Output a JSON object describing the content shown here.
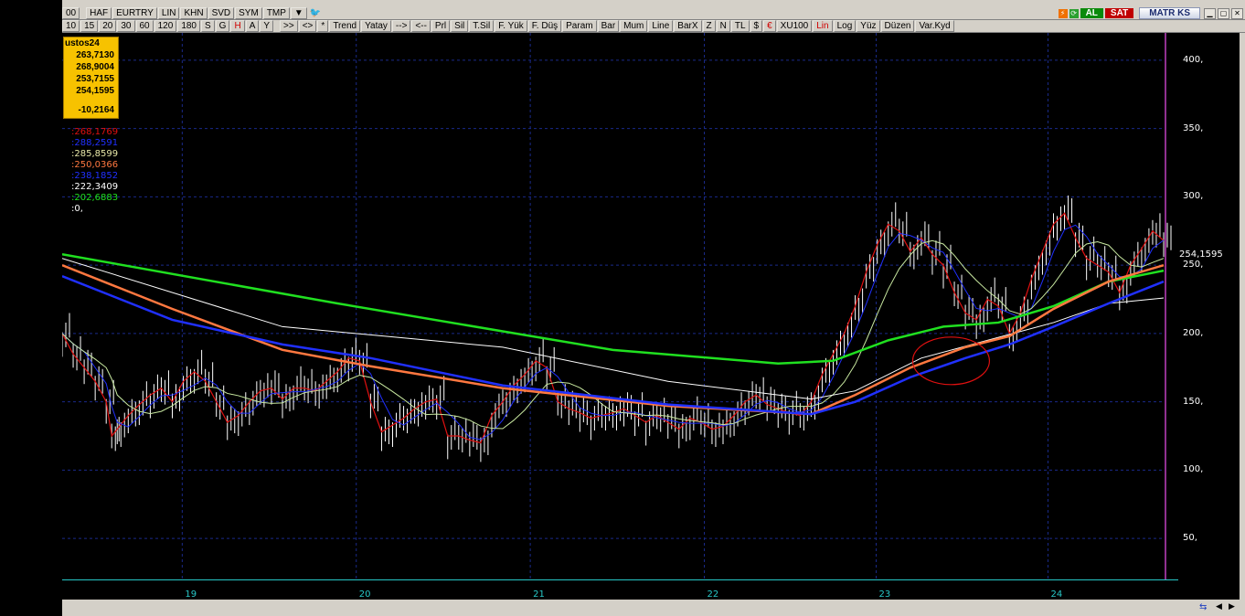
{
  "toolbar": {
    "row1": [
      "00",
      "HAF",
      "EURTRY",
      "LIN",
      "KHN",
      "SVD",
      "SYM",
      "TMP"
    ],
    "row2_periods": [
      "10",
      "15",
      "20",
      "30",
      "60",
      "120",
      "180",
      "S",
      "G",
      "H",
      "A",
      "Y"
    ],
    "row2_tools": [
      ">>",
      "<>",
      "*",
      "Trend",
      "Yatay",
      "-->",
      "<--",
      "Prl",
      "Sil",
      "T.Sil",
      "F. Yük",
      "F. Düş",
      "Param",
      "Bar",
      "Mum",
      "Line",
      "BarX",
      "Z",
      "N",
      "TL",
      "$",
      "€",
      "XU100",
      "Lin",
      "Log",
      "Yüz",
      "Düzen",
      "Var.Kyd"
    ],
    "al": "AL",
    "sat": "SAT",
    "brand": "MATR KS"
  },
  "infobox": {
    "title": "ustos24",
    "values": [
      "263,7130",
      "268,9004",
      "253,7155",
      "254,1595",
      "-10,2164"
    ]
  },
  "indicators": [
    {
      "value": ":268,1769",
      "color": "#e01010"
    },
    {
      "value": ":288,2591",
      "color": "#2030ff"
    },
    {
      "value": ":285,8599",
      "color": "#e8e8a8"
    },
    {
      "value": ":250,0366",
      "color": "#ff7840"
    },
    {
      "value": ":238,1852",
      "color": "#2030ff"
    },
    {
      "value": ":222,3409",
      "color": "#ffffff"
    },
    {
      "value": ":202,6883",
      "color": "#20e020"
    },
    {
      "value": ":0,",
      "color": "#ffffff"
    }
  ],
  "last_price": "254,1595",
  "chart_data": {
    "type": "line",
    "y_ticks": [
      "400,",
      "350,",
      "300,",
      "250,",
      "200,",
      "150,",
      "100,",
      "50,"
    ],
    "y_tick_values": [
      400,
      350,
      300,
      250,
      200,
      150,
      100,
      50
    ],
    "ylim": [
      20,
      420
    ],
    "x_ticks": [
      "19",
      "20",
      "21",
      "22",
      "23",
      "24"
    ],
    "x_tick_pos": [
      0.109,
      0.267,
      0.425,
      0.583,
      0.739,
      0.895
    ],
    "price": [
      [
        0,
        200
      ],
      [
        0.01,
        185
      ],
      [
        0.02,
        175
      ],
      [
        0.03,
        165
      ],
      [
        0.04,
        150
      ],
      [
        0.045,
        125
      ],
      [
        0.05,
        130
      ],
      [
        0.06,
        140
      ],
      [
        0.07,
        148
      ],
      [
        0.08,
        155
      ],
      [
        0.09,
        160
      ],
      [
        0.1,
        150
      ],
      [
        0.11,
        165
      ],
      [
        0.12,
        172
      ],
      [
        0.13,
        165
      ],
      [
        0.14,
        150
      ],
      [
        0.15,
        135
      ],
      [
        0.16,
        140
      ],
      [
        0.17,
        150
      ],
      [
        0.18,
        158
      ],
      [
        0.19,
        160
      ],
      [
        0.2,
        152
      ],
      [
        0.21,
        160
      ],
      [
        0.22,
        160
      ],
      [
        0.23,
        158
      ],
      [
        0.24,
        165
      ],
      [
        0.25,
        172
      ],
      [
        0.26,
        182
      ],
      [
        0.27,
        180
      ],
      [
        0.28,
        150
      ],
      [
        0.29,
        128
      ],
      [
        0.3,
        133
      ],
      [
        0.31,
        138
      ],
      [
        0.32,
        145
      ],
      [
        0.33,
        150
      ],
      [
        0.34,
        152
      ],
      [
        0.35,
        125
      ],
      [
        0.36,
        125
      ],
      [
        0.37,
        122
      ],
      [
        0.38,
        120
      ],
      [
        0.39,
        140
      ],
      [
        0.4,
        150
      ],
      [
        0.41,
        162
      ],
      [
        0.42,
        170
      ],
      [
        0.43,
        180
      ],
      [
        0.44,
        175
      ],
      [
        0.45,
        150
      ],
      [
        0.46,
        145
      ],
      [
        0.47,
        142
      ],
      [
        0.48,
        138
      ],
      [
        0.49,
        140
      ],
      [
        0.5,
        142
      ],
      [
        0.51,
        145
      ],
      [
        0.52,
        140
      ],
      [
        0.53,
        135
      ],
      [
        0.54,
        140
      ],
      [
        0.55,
        135
      ],
      [
        0.56,
        130
      ],
      [
        0.57,
        138
      ],
      [
        0.58,
        135
      ],
      [
        0.59,
        130
      ],
      [
        0.6,
        132
      ],
      [
        0.61,
        140
      ],
      [
        0.62,
        150
      ],
      [
        0.63,
        155
      ],
      [
        0.64,
        148
      ],
      [
        0.65,
        145
      ],
      [
        0.66,
        142
      ],
      [
        0.67,
        140
      ],
      [
        0.68,
        150
      ],
      [
        0.69,
        170
      ],
      [
        0.7,
        185
      ],
      [
        0.71,
        200
      ],
      [
        0.72,
        220
      ],
      [
        0.73,
        245
      ],
      [
        0.74,
        265
      ],
      [
        0.75,
        280
      ],
      [
        0.76,
        275
      ],
      [
        0.77,
        260
      ],
      [
        0.78,
        270
      ],
      [
        0.79,
        258
      ],
      [
        0.8,
        250
      ],
      [
        0.81,
        230
      ],
      [
        0.82,
        215
      ],
      [
        0.83,
        210
      ],
      [
        0.84,
        225
      ],
      [
        0.85,
        220
      ],
      [
        0.86,
        200
      ],
      [
        0.87,
        215
      ],
      [
        0.88,
        240
      ],
      [
        0.89,
        260
      ],
      [
        0.9,
        280
      ],
      [
        0.91,
        288
      ],
      [
        0.92,
        270
      ],
      [
        0.93,
        255
      ],
      [
        0.94,
        250
      ],
      [
        0.95,
        245
      ],
      [
        0.96,
        230
      ],
      [
        0.97,
        250
      ],
      [
        0.98,
        262
      ],
      [
        0.99,
        275
      ],
      [
        1.0,
        268
      ]
    ],
    "series": [
      {
        "values": [
          [
            0,
            258
          ],
          [
            0.25,
            222
          ],
          [
            0.5,
            188
          ],
          [
            0.65,
            178
          ],
          [
            0.7,
            180
          ],
          [
            0.75,
            195
          ],
          [
            0.8,
            205
          ],
          [
            0.85,
            208
          ],
          [
            0.9,
            220
          ],
          [
            0.95,
            238
          ],
          [
            1.0,
            246
          ]
        ],
        "color": "#20e020"
      },
      {
        "values": [
          [
            0,
            255
          ],
          [
            0.2,
            205
          ],
          [
            0.4,
            190
          ],
          [
            0.55,
            165
          ],
          [
            0.68,
            152
          ],
          [
            0.72,
            158
          ],
          [
            0.78,
            182
          ],
          [
            0.84,
            195
          ],
          [
            0.9,
            208
          ],
          [
            0.95,
            222
          ],
          [
            1.0,
            226
          ]
        ],
        "color": "#ffffff"
      },
      {
        "values": [
          [
            0,
            250
          ],
          [
            0.1,
            218
          ],
          [
            0.2,
            188
          ],
          [
            0.28,
            176
          ],
          [
            0.4,
            160
          ],
          [
            0.55,
            147
          ],
          [
            0.68,
            141
          ],
          [
            0.72,
            155
          ],
          [
            0.77,
            175
          ],
          [
            0.82,
            190
          ],
          [
            0.86,
            198
          ],
          [
            0.9,
            218
          ],
          [
            0.95,
            238
          ],
          [
            1.0,
            250
          ]
        ],
        "color": "#ff7840"
      },
      {
        "values": [
          [
            0,
            242
          ],
          [
            0.1,
            210
          ],
          [
            0.2,
            192
          ],
          [
            0.28,
            182
          ],
          [
            0.4,
            162
          ],
          [
            0.55,
            148
          ],
          [
            0.68,
            141
          ],
          [
            0.72,
            150
          ],
          [
            0.77,
            168
          ],
          [
            0.82,
            182
          ],
          [
            0.86,
            192
          ],
          [
            0.9,
            205
          ],
          [
            0.95,
            222
          ],
          [
            1.0,
            238
          ]
        ],
        "color": "#2030ff"
      }
    ]
  }
}
